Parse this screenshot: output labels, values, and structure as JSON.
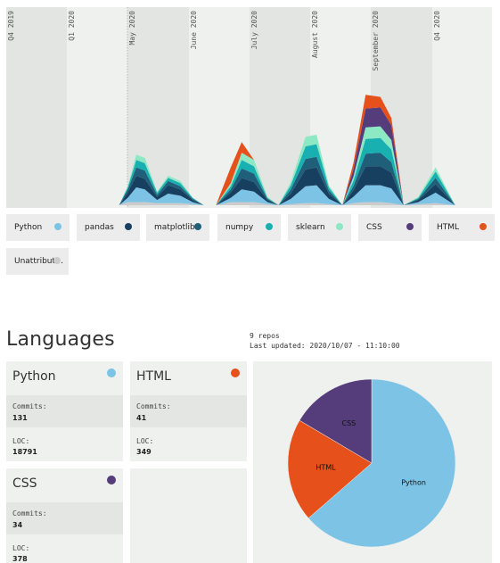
{
  "chart_data": [
    {
      "type": "area",
      "stacked": true,
      "x": [
        "2019-10-01",
        "2019-10-15",
        "2019-11-01",
        "2019-11-15",
        "2019-12-01",
        "2019-12-15",
        "2020-01-01",
        "2020-01-08",
        "2020-01-15",
        "2020-01-22",
        "2020-02-01",
        "2020-02-10",
        "2020-02-20",
        "2020-03-01",
        "2020-03-10",
        "2020-03-20",
        "2020-04-01",
        "2020-04-10",
        "2020-04-20",
        "2020-05-01",
        "2020-05-10",
        "2020-05-20",
        "2020-06-01",
        "2020-06-10",
        "2020-06-20",
        "2020-07-01",
        "2020-07-10",
        "2020-07-20",
        "2020-08-01",
        "2020-08-10",
        "2020-08-20",
        "2020-09-01",
        "2020-09-15",
        "2020-10-01",
        "2020-10-07"
      ],
      "x_ticks": [
        "Q4 2019",
        "Q1 2020",
        "May 2020",
        "June 2020",
        "July 2020",
        "August 2020",
        "September 2020",
        "Q4 2020"
      ],
      "grid": true,
      "series": [
        {
          "name": "Python",
          "color": "#7cc3e6",
          "values": [
            0,
            0,
            0,
            0,
            0,
            0,
            0,
            4,
            14,
            12,
            3,
            9,
            7,
            2,
            0,
            0,
            4,
            12,
            10,
            2,
            0,
            5,
            16,
            17,
            5,
            0,
            6,
            16,
            16,
            14,
            0,
            2,
            10,
            0,
            0
          ]
        },
        {
          "name": "pandas",
          "color": "#173f5f",
          "values": [
            0,
            0,
            0,
            0,
            0,
            0,
            0,
            5,
            11,
            10,
            3,
            8,
            6,
            2,
            0,
            0,
            5,
            11,
            9,
            2,
            0,
            5,
            16,
            17,
            5,
            0,
            6,
            18,
            18,
            15,
            0,
            2,
            8,
            0,
            0
          ]
        },
        {
          "name": "matplotlib",
          "color": "#1f5f7a",
          "values": [
            0,
            0,
            0,
            0,
            0,
            0,
            0,
            3,
            8,
            8,
            2,
            4,
            3,
            1,
            0,
            0,
            3,
            9,
            8,
            1,
            0,
            4,
            10,
            10,
            3,
            0,
            4,
            12,
            13,
            10,
            0,
            1,
            6,
            0,
            0
          ]
        },
        {
          "name": "numpy",
          "color": "#18b0b0",
          "values": [
            0,
            0,
            0,
            0,
            0,
            0,
            0,
            2,
            7,
            7,
            2,
            3,
            3,
            1,
            0,
            0,
            3,
            8,
            7,
            1,
            0,
            4,
            12,
            12,
            3,
            0,
            5,
            14,
            14,
            12,
            0,
            1,
            6,
            0,
            0
          ]
        },
        {
          "name": "sklearn",
          "color": "#8de8c4",
          "values": [
            0,
            0,
            0,
            0,
            0,
            0,
            0,
            1,
            5,
            5,
            1,
            2,
            2,
            0,
            0,
            0,
            3,
            7,
            6,
            1,
            0,
            3,
            9,
            9,
            2,
            0,
            4,
            11,
            11,
            9,
            0,
            1,
            4,
            0,
            0
          ]
        },
        {
          "name": "CSS",
          "color": "#553c7b",
          "values": [
            0,
            0,
            0,
            0,
            0,
            0,
            0,
            0,
            0,
            0,
            0,
            0,
            0,
            0,
            0,
            0,
            0,
            0,
            0,
            0,
            0,
            0,
            0,
            0,
            0,
            0,
            7,
            18,
            18,
            14,
            0,
            0,
            0,
            0,
            0
          ]
        },
        {
          "name": "HTML",
          "color": "#e6501b",
          "values": [
            0,
            0,
            0,
            0,
            0,
            0,
            0,
            0,
            0,
            0,
            0,
            0,
            0,
            0,
            0,
            0,
            15,
            10,
            0,
            0,
            0,
            0,
            0,
            0,
            0,
            0,
            6,
            13,
            10,
            7,
            0,
            0,
            0,
            0,
            0
          ]
        },
        {
          "name": "Unattributed",
          "color": "#cccccc",
          "values": [
            0,
            0,
            0,
            0,
            0,
            0,
            0,
            3,
            3,
            3,
            2,
            2,
            2,
            1,
            0,
            0,
            3,
            3,
            3,
            1,
            0,
            1,
            2,
            2,
            1,
            0,
            2,
            3,
            3,
            2,
            0,
            1,
            2,
            0,
            0
          ]
        }
      ]
    },
    {
      "type": "pie",
      "slices": [
        {
          "label": "Python",
          "value": 131,
          "color": "#7cc3e6"
        },
        {
          "label": "HTML",
          "value": 41,
          "color": "#e6501b"
        },
        {
          "label": "CSS",
          "value": 34,
          "color": "#553c7b"
        }
      ]
    }
  ],
  "legend": [
    {
      "label": "Python",
      "color": "#7cc3e6"
    },
    {
      "label": "pandas",
      "color": "#173f5f"
    },
    {
      "label": "matplotlib",
      "color": "#1f5f7a"
    },
    {
      "label": "numpy",
      "color": "#18b0b0"
    },
    {
      "label": "sklearn",
      "color": "#8de8c4"
    },
    {
      "label": "CSS",
      "color": "#553c7b"
    },
    {
      "label": "HTML",
      "color": "#e6501b"
    },
    {
      "label": "Unattributed",
      "color": "#cccccc"
    }
  ],
  "languages": {
    "title": "Languages",
    "repos": "9 repos",
    "updated": "Last updated: 2020/10/07 - 11:10:00",
    "commits_label": "Commits:",
    "loc_label": "LOC:",
    "cards": [
      {
        "name": "Python",
        "color": "#7cc3e6",
        "commits": "131",
        "loc": "18791"
      },
      {
        "name": "HTML",
        "color": "#e6501b",
        "commits": "41",
        "loc": "349"
      },
      {
        "name": "CSS",
        "color": "#553c7b",
        "commits": "34",
        "loc": "378"
      }
    ]
  }
}
